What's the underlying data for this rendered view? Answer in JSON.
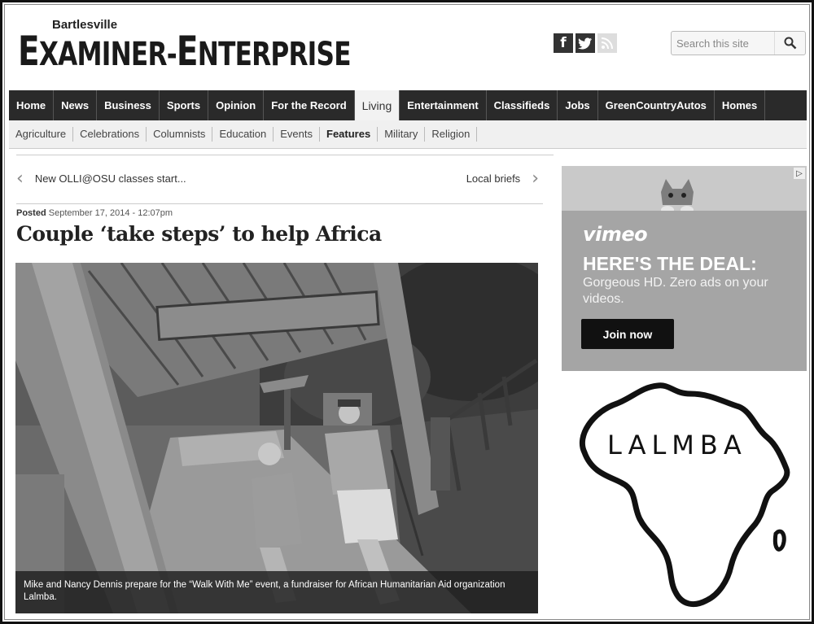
{
  "masthead": {
    "city": "Bartlesville",
    "paper_name_1": "E",
    "paper_name_2": "XAMINER-",
    "paper_name_3": "E",
    "paper_name_4": "NTERPRISE"
  },
  "social": {
    "facebook": "f",
    "twitter": "t",
    "rss": "rss"
  },
  "search": {
    "placeholder": "Search this site"
  },
  "nav": {
    "items": [
      "Home",
      "News",
      "Business",
      "Sports",
      "Opinion",
      "For the Record",
      "Living",
      "Entertainment",
      "Classifieds",
      "Jobs",
      "GreenCountryAutos",
      "Homes"
    ],
    "active": "Living"
  },
  "subnav": {
    "items": [
      "Agriculture",
      "Celebrations",
      "Columnists",
      "Education",
      "Events",
      "Features",
      "Military",
      "Religion"
    ],
    "active": "Features"
  },
  "article": {
    "prev": "New OLLI@OSU classes start...",
    "next": "Local briefs",
    "posted_label": "Posted",
    "posted_date": "September 17, 2014 - 12:07pm",
    "headline": "Couple ‘take steps’ to help Africa",
    "caption": "Mike and Nancy Dennis prepare for the “Walk With Me” event, a fundraiser for African Humanitarian Aid organization Lalmba."
  },
  "ad": {
    "brand": "vimeo",
    "headline": "HERE'S THE DEAL:",
    "subtext": "Gorgeous HD. Zero ads on your videos.",
    "cta": "Join now"
  },
  "logo": {
    "text": "LALMBA"
  }
}
